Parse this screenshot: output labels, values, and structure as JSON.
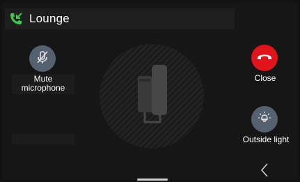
{
  "header": {
    "title": "Lounge",
    "icon": "call-incoming-icon",
    "icon_color": "#3cc84a"
  },
  "actions": {
    "mute": {
      "label": "Mute microphone",
      "line1": "Mute",
      "line2": "microphone",
      "icon": "microphone-muted-icon",
      "color": "#55616e"
    },
    "close": {
      "label": "Close",
      "icon": "hang-up-icon",
      "color": "#e1141c"
    },
    "light": {
      "label": "Outside light",
      "icon": "light-bulb-icon",
      "color": "#55616e"
    }
  },
  "center": {
    "icon": "intercom-handset-icon"
  },
  "navigation": {
    "back_icon": "chevron-left-icon"
  }
}
